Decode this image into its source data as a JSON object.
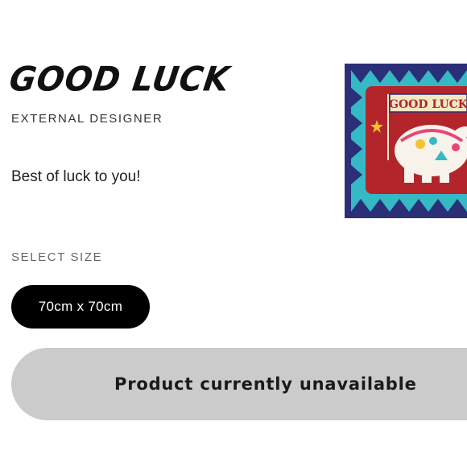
{
  "product": {
    "title": "GOOD LUCK",
    "designer": "EXTERNAL DESIGNER",
    "description": "Best of luck to you!",
    "image_banner_text": "GOOD LUCK"
  },
  "size_selector": {
    "label": "SELECT SIZE",
    "options": [
      "70cm x 70cm"
    ],
    "selected": "70cm x 70cm"
  },
  "cta": {
    "label": "Product currently unavailable"
  },
  "colors": {
    "selected_size_bg": "#000000",
    "cta_bg": "#cbcbcb",
    "scarf_navy": "#2b2f78",
    "scarf_turquoise": "#35b9c4",
    "scarf_red": "#b3252a"
  }
}
